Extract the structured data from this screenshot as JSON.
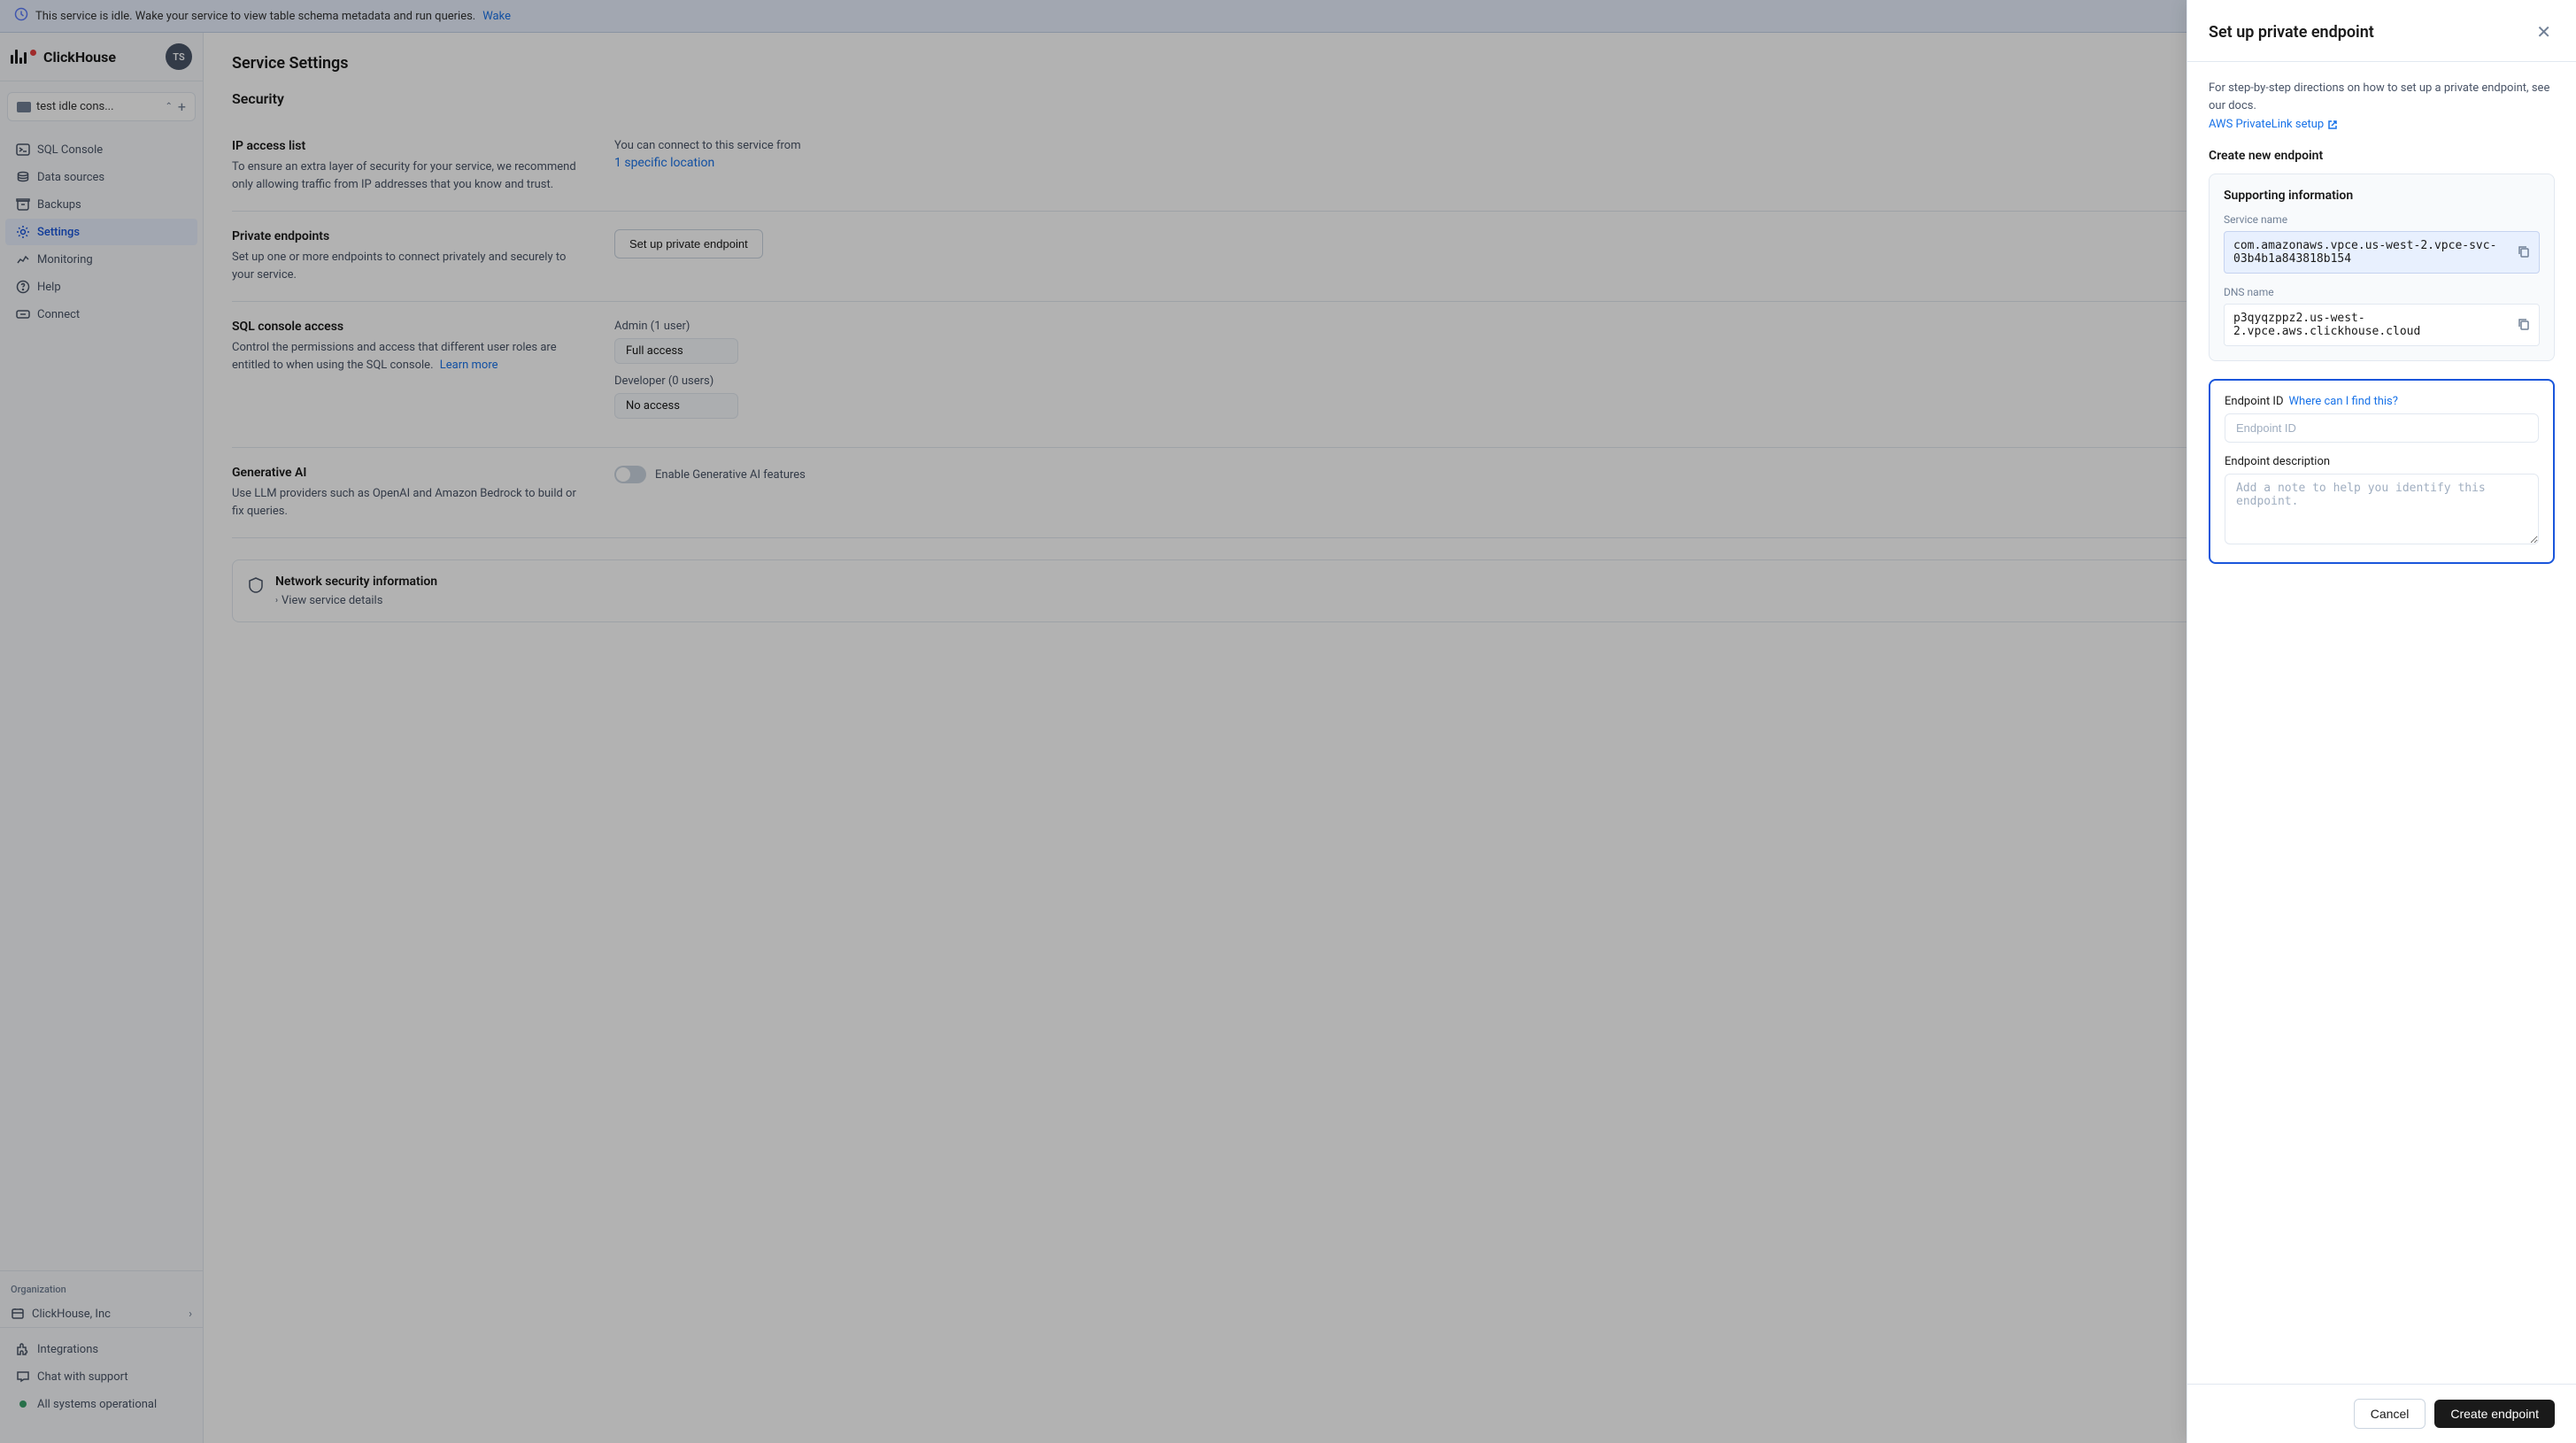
{
  "banner": {
    "text": "This service is idle. Wake your service to view table schema metadata and run queries.",
    "link_text": "Wake",
    "icon": "clock-icon"
  },
  "sidebar": {
    "logo_text": "ClickHouse",
    "user_initials": "TS",
    "service_name": "test idle cons...",
    "nav_items": [
      {
        "id": "sql-console",
        "label": "SQL Console",
        "icon": "terminal-icon"
      },
      {
        "id": "data-sources",
        "label": "Data sources",
        "icon": "database-icon"
      },
      {
        "id": "backups",
        "label": "Backups",
        "icon": "archive-icon"
      },
      {
        "id": "settings",
        "label": "Settings",
        "icon": "settings-icon",
        "active": true
      },
      {
        "id": "monitoring",
        "label": "Monitoring",
        "icon": "chart-icon"
      },
      {
        "id": "help",
        "label": "Help",
        "icon": "help-icon"
      },
      {
        "id": "connect",
        "label": "Connect",
        "icon": "link-icon"
      }
    ],
    "organization_label": "Organization",
    "org_name": "ClickHouse, Inc",
    "bottom_items": [
      {
        "id": "integrations",
        "label": "Integrations",
        "icon": "puzzle-icon"
      },
      {
        "id": "chat-support",
        "label": "Chat with support",
        "icon": "chat-icon"
      },
      {
        "id": "all-systems",
        "label": "All systems operational",
        "icon": "status-icon"
      }
    ]
  },
  "main": {
    "page_title": "Service Settings",
    "section_title": "Security",
    "ip_access": {
      "title": "IP access list",
      "description": "To ensure an extra layer of security for your service, we recommend only allowing traffic from IP addresses that you know and trust.",
      "connection_text": "You can connect to this service from",
      "location_text": "1 specific location"
    },
    "private_endpoints": {
      "title": "Private endpoints",
      "description": "Set up one or more endpoints to connect privately and securely to your service.",
      "button_label": "Set up private endpoint"
    },
    "sql_console": {
      "title": "SQL console access",
      "description": "Control the permissions and access that different user roles are entitled to when using the SQL console.",
      "learn_more": "Learn more",
      "admin_label": "Admin (1 user)",
      "admin_access": "Full access",
      "developer_label": "Developer (0 users)",
      "developer_access": "No access"
    },
    "generative_ai": {
      "title": "Generative AI",
      "description": "Use LLM providers such as OpenAI and Amazon Bedrock to build or fix queries.",
      "toggle_label": "Enable Generative AI features",
      "enabled": false
    },
    "network_security": {
      "title": "Network security information",
      "view_details": "View service details"
    }
  },
  "panel": {
    "title": "Set up private endpoint",
    "description": "For step-by-step directions on how to set up a private endpoint, see our docs.",
    "aws_link": "AWS PrivateLink setup",
    "create_section": "Create new endpoint",
    "supporting_info": {
      "title": "Supporting information",
      "service_name_label": "Service name",
      "service_name_value": "com.amazonaws.vpce.us-west-2.vpce-svc-03b4b1a843818b154",
      "dns_name_label": "DNS name",
      "dns_name_value": "p3qyqzppz2.us-west-2.vpce.aws.clickhouse.cloud"
    },
    "endpoint_form": {
      "endpoint_id_label": "Endpoint ID",
      "where_to_find": "Where can I find this?",
      "endpoint_id_placeholder": "Endpoint ID",
      "description_label": "Endpoint description",
      "description_placeholder": "Add a note to help you identify this endpoint."
    },
    "cancel_label": "Cancel",
    "create_label": "Create endpoint"
  }
}
